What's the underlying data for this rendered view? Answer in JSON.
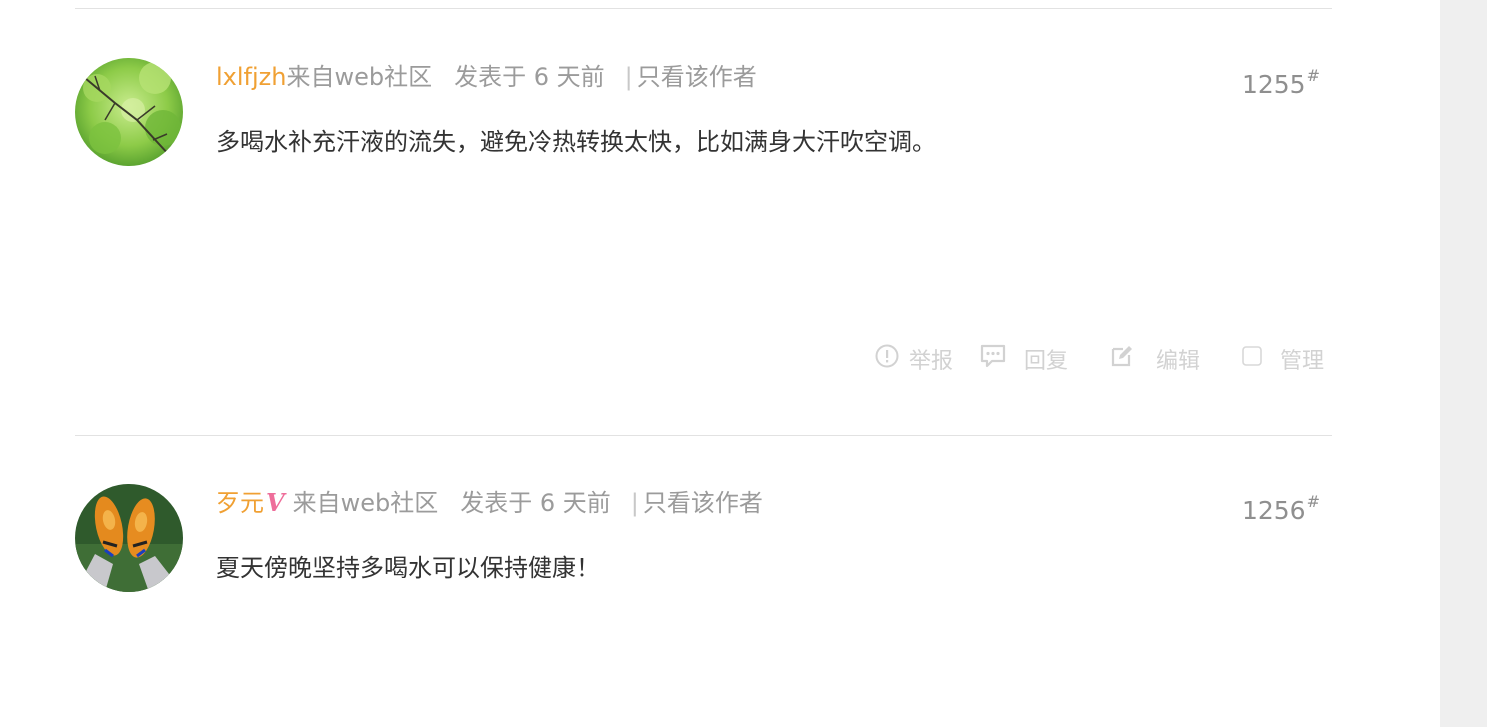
{
  "posts": [
    {
      "username": "lxlfjzh",
      "verified": false,
      "source": "来自web社区",
      "posted": "发表于 6 天前",
      "separator": "|",
      "only_author": "只看该作者",
      "floor": "1255",
      "floor_mark": "#",
      "content": "多喝水补充汗液的流失，避免冷热转换太快，比如满身大汗吹空调。",
      "avatar_icon": "green-leaves-avatar"
    },
    {
      "username": "歹元",
      "verified": true,
      "verified_badge": "V",
      "source": "来自web社区",
      "posted": "发表于 6 天前",
      "separator": "|",
      "only_author": "只看该作者",
      "floor": "1256",
      "floor_mark": "#",
      "content": "夏天傍晚坚持多喝水可以保持健康！",
      "avatar_icon": "orange-shoes-avatar"
    }
  ],
  "actions": {
    "report": "举报",
    "reply": "回复",
    "edit": "编辑",
    "manage": "管理"
  },
  "colors": {
    "username": "#f0a033",
    "meta": "#9b9b9b",
    "content": "#333333",
    "actions": "#d2d2d2",
    "verified": "#ee6d9a",
    "gutter": "#efefef"
  }
}
